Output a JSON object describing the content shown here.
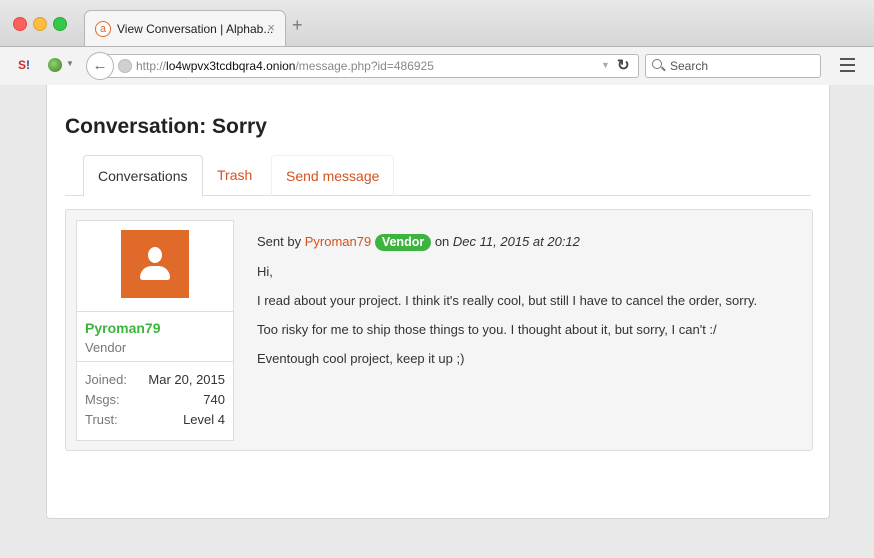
{
  "browser": {
    "tab_title": "View Conversation | Alphab...",
    "tab_close": "×",
    "new_tab": "+",
    "favicon_letter": "a",
    "url_prefix": "http://",
    "url_domain": "lo4wpvx3tcdbqra4.onion",
    "url_path": "/message.php?id=486925",
    "search_placeholder": "Search",
    "extension_label": "S",
    "extension_label_suffix": "!"
  },
  "page": {
    "title": "Conversation: Sorry",
    "tabs": [
      {
        "label": "Conversations",
        "active": true
      },
      {
        "label": "Trash",
        "active": false
      },
      {
        "label": "Send message",
        "active": false
      }
    ]
  },
  "user": {
    "name": "Pyroman79",
    "role": "Vendor",
    "stats": [
      {
        "label": "Joined:",
        "value": "Mar 20, 2015"
      },
      {
        "label": "Msgs:",
        "value": "740"
      },
      {
        "label": "Trust:",
        "value": "Level 4"
      }
    ]
  },
  "message": {
    "sent_by_prefix": "Sent by",
    "sender": "Pyroman79",
    "badge": "Vendor",
    "on_label": "on",
    "date": "Dec 11, 2015 at 20:12",
    "lines": [
      "Hi,",
      "I read about your project. I think it's really cool, but still I have to cancel the order, sorry.",
      "Too risky for me to ship those things to you. I thought about it, but sorry, I can't :/",
      "Eventough cool project, keep it up ;)"
    ]
  },
  "colors": {
    "accent": "#d2531e",
    "vendor_green": "#3fb33f",
    "avatar_bg": "#e06a2a"
  }
}
